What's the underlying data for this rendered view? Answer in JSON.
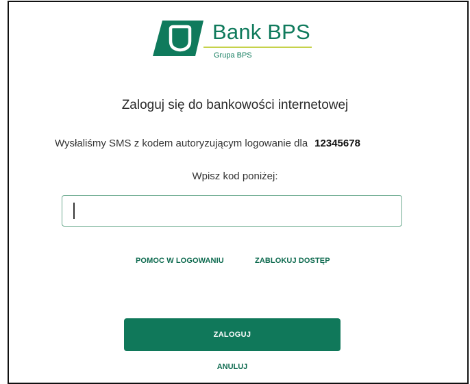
{
  "logo": {
    "name": "Bank BPS",
    "subtitle": "Grupa BPS",
    "brand_color": "#0f7a5c",
    "accent_color": "#c6d24a",
    "icon": "bank-bps-logo-icon"
  },
  "login": {
    "title": "Zaloguj się do bankowości internetowej",
    "sms_message": "Wysłaliśmy SMS z kodem autoryzującym logowanie dla",
    "user_number": "12345678",
    "prompt": "Wpisz kod poniżej:",
    "code_value": ""
  },
  "links": {
    "help": "POMOC W LOGOWANIU",
    "block_access": "ZABLOKUJ DOSTĘP"
  },
  "actions": {
    "login": "ZALOGUJ",
    "cancel": "ANULUJ",
    "button_color": "#10785a"
  }
}
